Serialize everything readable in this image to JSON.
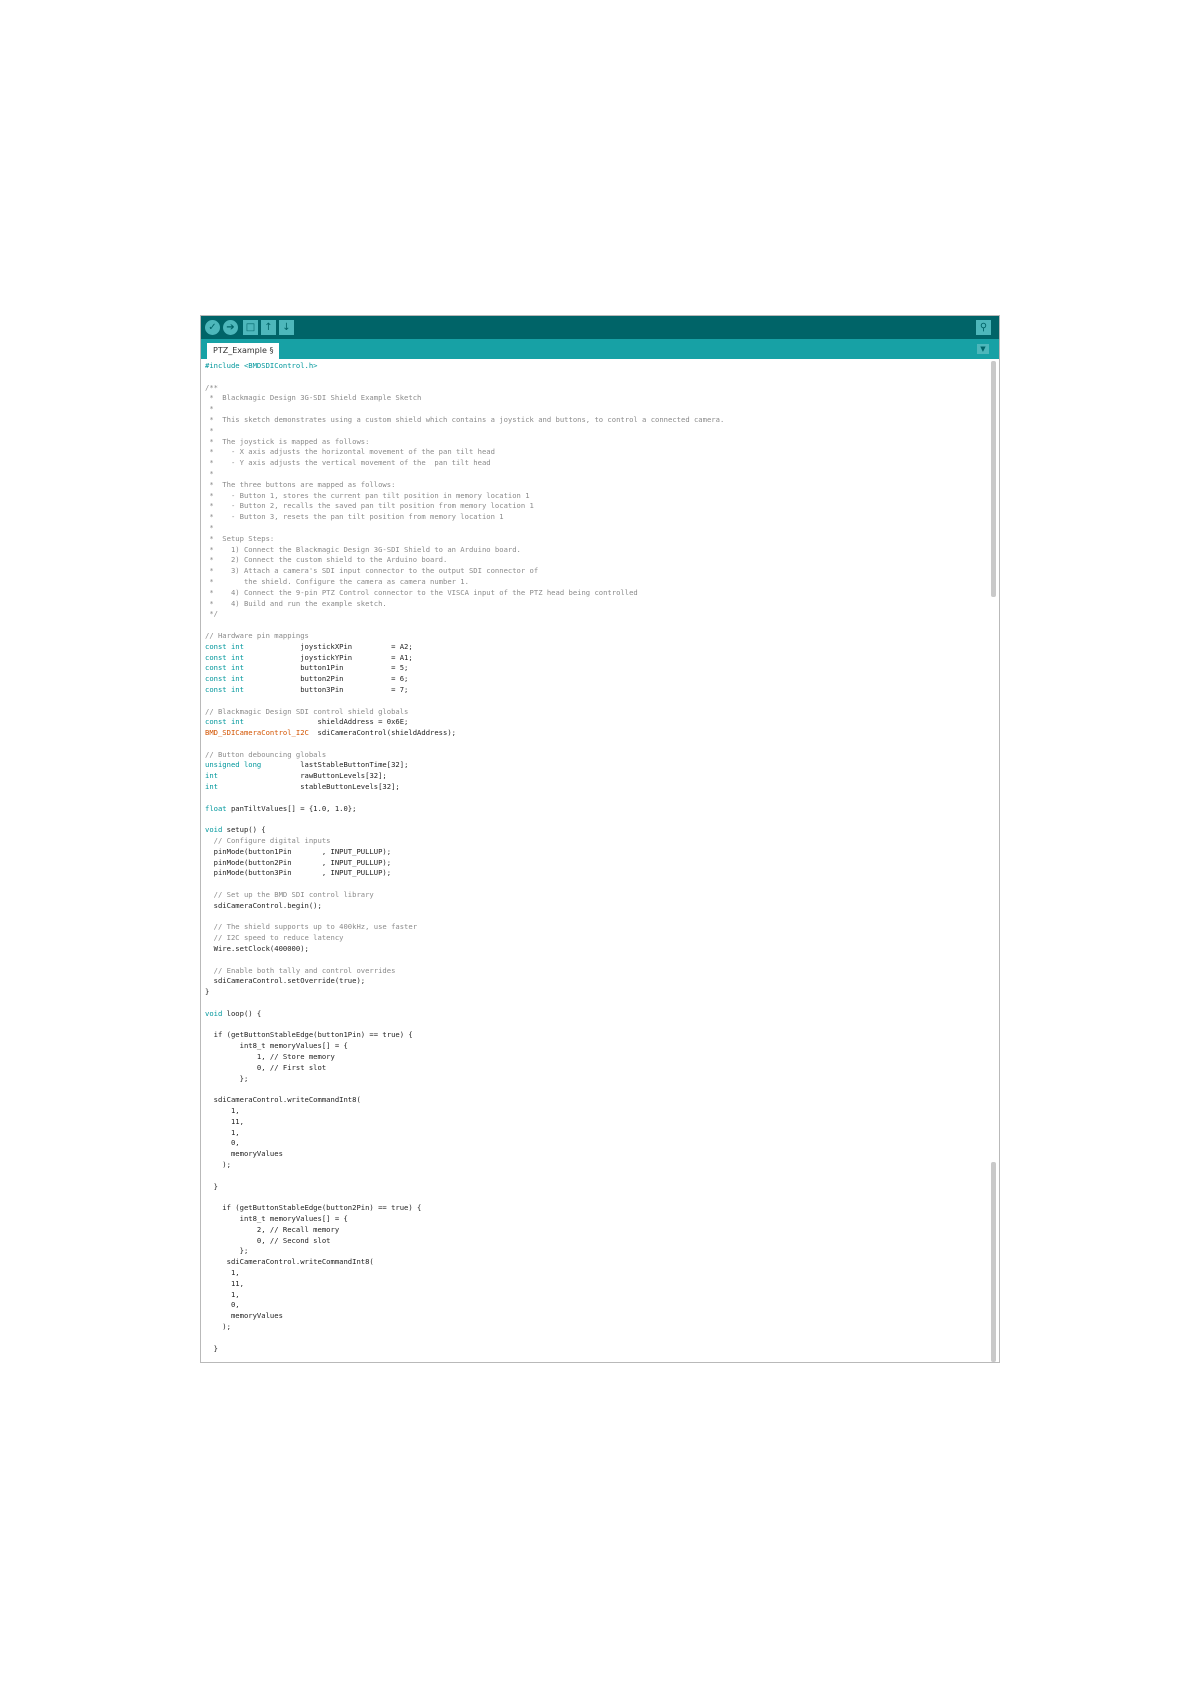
{
  "toolbar": {
    "buttons": [
      {
        "icon": "verify-icon"
      },
      {
        "icon": "upload-icon"
      },
      {
        "icon": "new-icon"
      },
      {
        "icon": "open-icon"
      },
      {
        "icon": "save-icon"
      }
    ],
    "serial_monitor_icon": "serial-monitor-icon"
  },
  "tab": {
    "label": "PTZ_Example §"
  },
  "tab_menu_icon": "tab-menu-icon",
  "colors": {
    "toolbar": "#006468",
    "tabbar": "#17a1a5",
    "keyword": "#00979c",
    "function": "#d35400",
    "comment": "#8a8a8a"
  },
  "code_lines": [
    {
      "text": "#include <BMDSDIControl.h>",
      "s": "k"
    },
    {
      "text": "",
      "s": ""
    },
    {
      "text": "/**",
      "s": "c"
    },
    {
      "text": " *  Blackmagic Design 3G-SDI Shield Example Sketch",
      "s": "c"
    },
    {
      "text": " *",
      "s": "c"
    },
    {
      "text": " *  This sketch demonstrates using a custom shield which contains a joystick and buttons, to control a connected camera.",
      "s": "c"
    },
    {
      "text": " *",
      "s": "c"
    },
    {
      "text": " *  The joystick is mapped as follows:",
      "s": "c"
    },
    {
      "text": " *    - X axis adjusts the horizontal movement of the pan tilt head",
      "s": "c"
    },
    {
      "text": " *    - Y axis adjusts the vertical movement of the  pan tilt head",
      "s": "c"
    },
    {
      "text": " *",
      "s": "c"
    },
    {
      "text": " *  The three buttons are mapped as follows:",
      "s": "c"
    },
    {
      "text": " *    - Button 1, stores the current pan tilt position in memory location 1",
      "s": "c"
    },
    {
      "text": " *    - Button 2, recalls the saved pan tilt position from memory location 1",
      "s": "c"
    },
    {
      "text": " *    - Button 3, resets the pan tilt position from memory location 1",
      "s": "c"
    },
    {
      "text": " *",
      "s": "c"
    },
    {
      "text": " *  Setup Steps:",
      "s": "c"
    },
    {
      "text": " *    1) Connect the Blackmagic Design 3G-SDI Shield to an Arduino board.",
      "s": "c"
    },
    {
      "text": " *    2) Connect the custom shield to the Arduino board.",
      "s": "c"
    },
    {
      "text": " *    3) Attach a camera's SDI input connector to the output SDI connector of",
      "s": "c"
    },
    {
      "text": " *       the shield. Configure the camera as camera number 1.",
      "s": "c"
    },
    {
      "text": " *    4) Connect the 9-pin PTZ Control connector to the VISCA input of the PTZ head being controlled",
      "s": "c"
    },
    {
      "text": " *    4) Build and run the example sketch.",
      "s": "c"
    },
    {
      "text": " */",
      "s": "c"
    },
    {
      "text": "",
      "s": ""
    },
    {
      "text": "// Hardware pin mappings",
      "s": "c"
    },
    {
      "text": "const int             joystickXPin         = A2;",
      "s": "kw",
      "kw": "const int"
    },
    {
      "text": "const int             joystickYPin         = A1;",
      "s": "kw",
      "kw": "const int"
    },
    {
      "text": "const int             button1Pin           = 5;",
      "s": "kw",
      "kw": "const int"
    },
    {
      "text": "const int             button2Pin           = 6;",
      "s": "kw",
      "kw": "const int"
    },
    {
      "text": "const int             button3Pin           = 7;",
      "s": "kw",
      "kw": "const int"
    },
    {
      "text": "",
      "s": ""
    },
    {
      "text": "// Blackmagic Design SDI control shield globals",
      "s": "c"
    },
    {
      "text": "const int                 shieldAddress = 0x6E;",
      "s": "kw",
      "kw": "const int"
    },
    {
      "text": "BMD_SDICameraControl_I2C  sdiCameraControl(shieldAddress);",
      "s": "fw",
      "kw": "BMD_SDICameraControl_I2C"
    },
    {
      "text": "",
      "s": ""
    },
    {
      "text": "// Button debouncing globals",
      "s": "c"
    },
    {
      "text": "unsigned long         lastStableButtonTime[32];",
      "s": "kw",
      "kw": "unsigned long"
    },
    {
      "text": "int                   rawButtonLevels[32];",
      "s": "kw",
      "kw": "int"
    },
    {
      "text": "int                   stableButtonLevels[32];",
      "s": "kw",
      "kw": "int"
    },
    {
      "text": "",
      "s": ""
    },
    {
      "text": "float panTiltValues[] = {1.0, 1.0};",
      "s": "kw",
      "kw": "float"
    },
    {
      "text": "",
      "s": ""
    },
    {
      "text": "void setup() {",
      "s": "kw",
      "kw": "void"
    },
    {
      "text": "  // Configure digital inputs",
      "s": "c"
    },
    {
      "text": "  pinMode(button1Pin       , INPUT_PULLUP);",
      "s": "raw"
    },
    {
      "text": "  pinMode(button2Pin       , INPUT_PULLUP);",
      "s": "raw"
    },
    {
      "text": "  pinMode(button3Pin       , INPUT_PULLUP);",
      "s": "raw"
    },
    {
      "text": "",
      "s": ""
    },
    {
      "text": "  // Set up the BMD SDI control library",
      "s": "c"
    },
    {
      "text": "  sdiCameraControl.begin();",
      "s": "raw"
    },
    {
      "text": "",
      "s": ""
    },
    {
      "text": "  // The shield supports up to 400kHz, use faster",
      "s": "c"
    },
    {
      "text": "  // I2C speed to reduce latency",
      "s": "c"
    },
    {
      "text": "  Wire.setClock(400000);",
      "s": "raw"
    },
    {
      "text": "",
      "s": ""
    },
    {
      "text": "  // Enable both tally and control overrides",
      "s": "c"
    },
    {
      "text": "  sdiCameraControl.setOverride(true);",
      "s": "raw"
    },
    {
      "text": "}",
      "s": ""
    },
    {
      "text": "",
      "s": ""
    },
    {
      "text": "void loop() {",
      "s": "kw",
      "kw": "void"
    },
    {
      "text": "",
      "s": ""
    },
    {
      "text": "  if (getButtonStableEdge(button1Pin) == true) {",
      "s": "raw"
    },
    {
      "text": "        int8_t memoryValues[] = {",
      "s": "raw"
    },
    {
      "text": "            1, // Store memory",
      "s": "raw"
    },
    {
      "text": "            0, // First slot",
      "s": "raw"
    },
    {
      "text": "        };",
      "s": ""
    },
    {
      "text": "",
      "s": ""
    },
    {
      "text": "  sdiCameraControl.writeCommandInt8(",
      "s": "raw"
    },
    {
      "text": "      1,",
      "s": ""
    },
    {
      "text": "      11,",
      "s": ""
    },
    {
      "text": "      1,",
      "s": ""
    },
    {
      "text": "      0,",
      "s": ""
    },
    {
      "text": "      memoryValues",
      "s": ""
    },
    {
      "text": "    );",
      "s": ""
    },
    {
      "text": "",
      "s": ""
    },
    {
      "text": "  }",
      "s": ""
    },
    {
      "text": "",
      "s": ""
    },
    {
      "text": "    if (getButtonStableEdge(button2Pin) == true) {",
      "s": "raw"
    },
    {
      "text": "        int8_t memoryValues[] = {",
      "s": "raw"
    },
    {
      "text": "            2, // Recall memory",
      "s": "raw"
    },
    {
      "text": "            0, // Second slot",
      "s": "raw"
    },
    {
      "text": "        };",
      "s": ""
    },
    {
      "text": "     sdiCameraControl.writeCommandInt8(",
      "s": "raw"
    },
    {
      "text": "      1,",
      "s": ""
    },
    {
      "text": "      11,",
      "s": ""
    },
    {
      "text": "      1,",
      "s": ""
    },
    {
      "text": "      0,",
      "s": ""
    },
    {
      "text": "      memoryValues",
      "s": ""
    },
    {
      "text": "    );",
      "s": ""
    },
    {
      "text": "",
      "s": ""
    },
    {
      "text": "  }",
      "s": ""
    }
  ]
}
